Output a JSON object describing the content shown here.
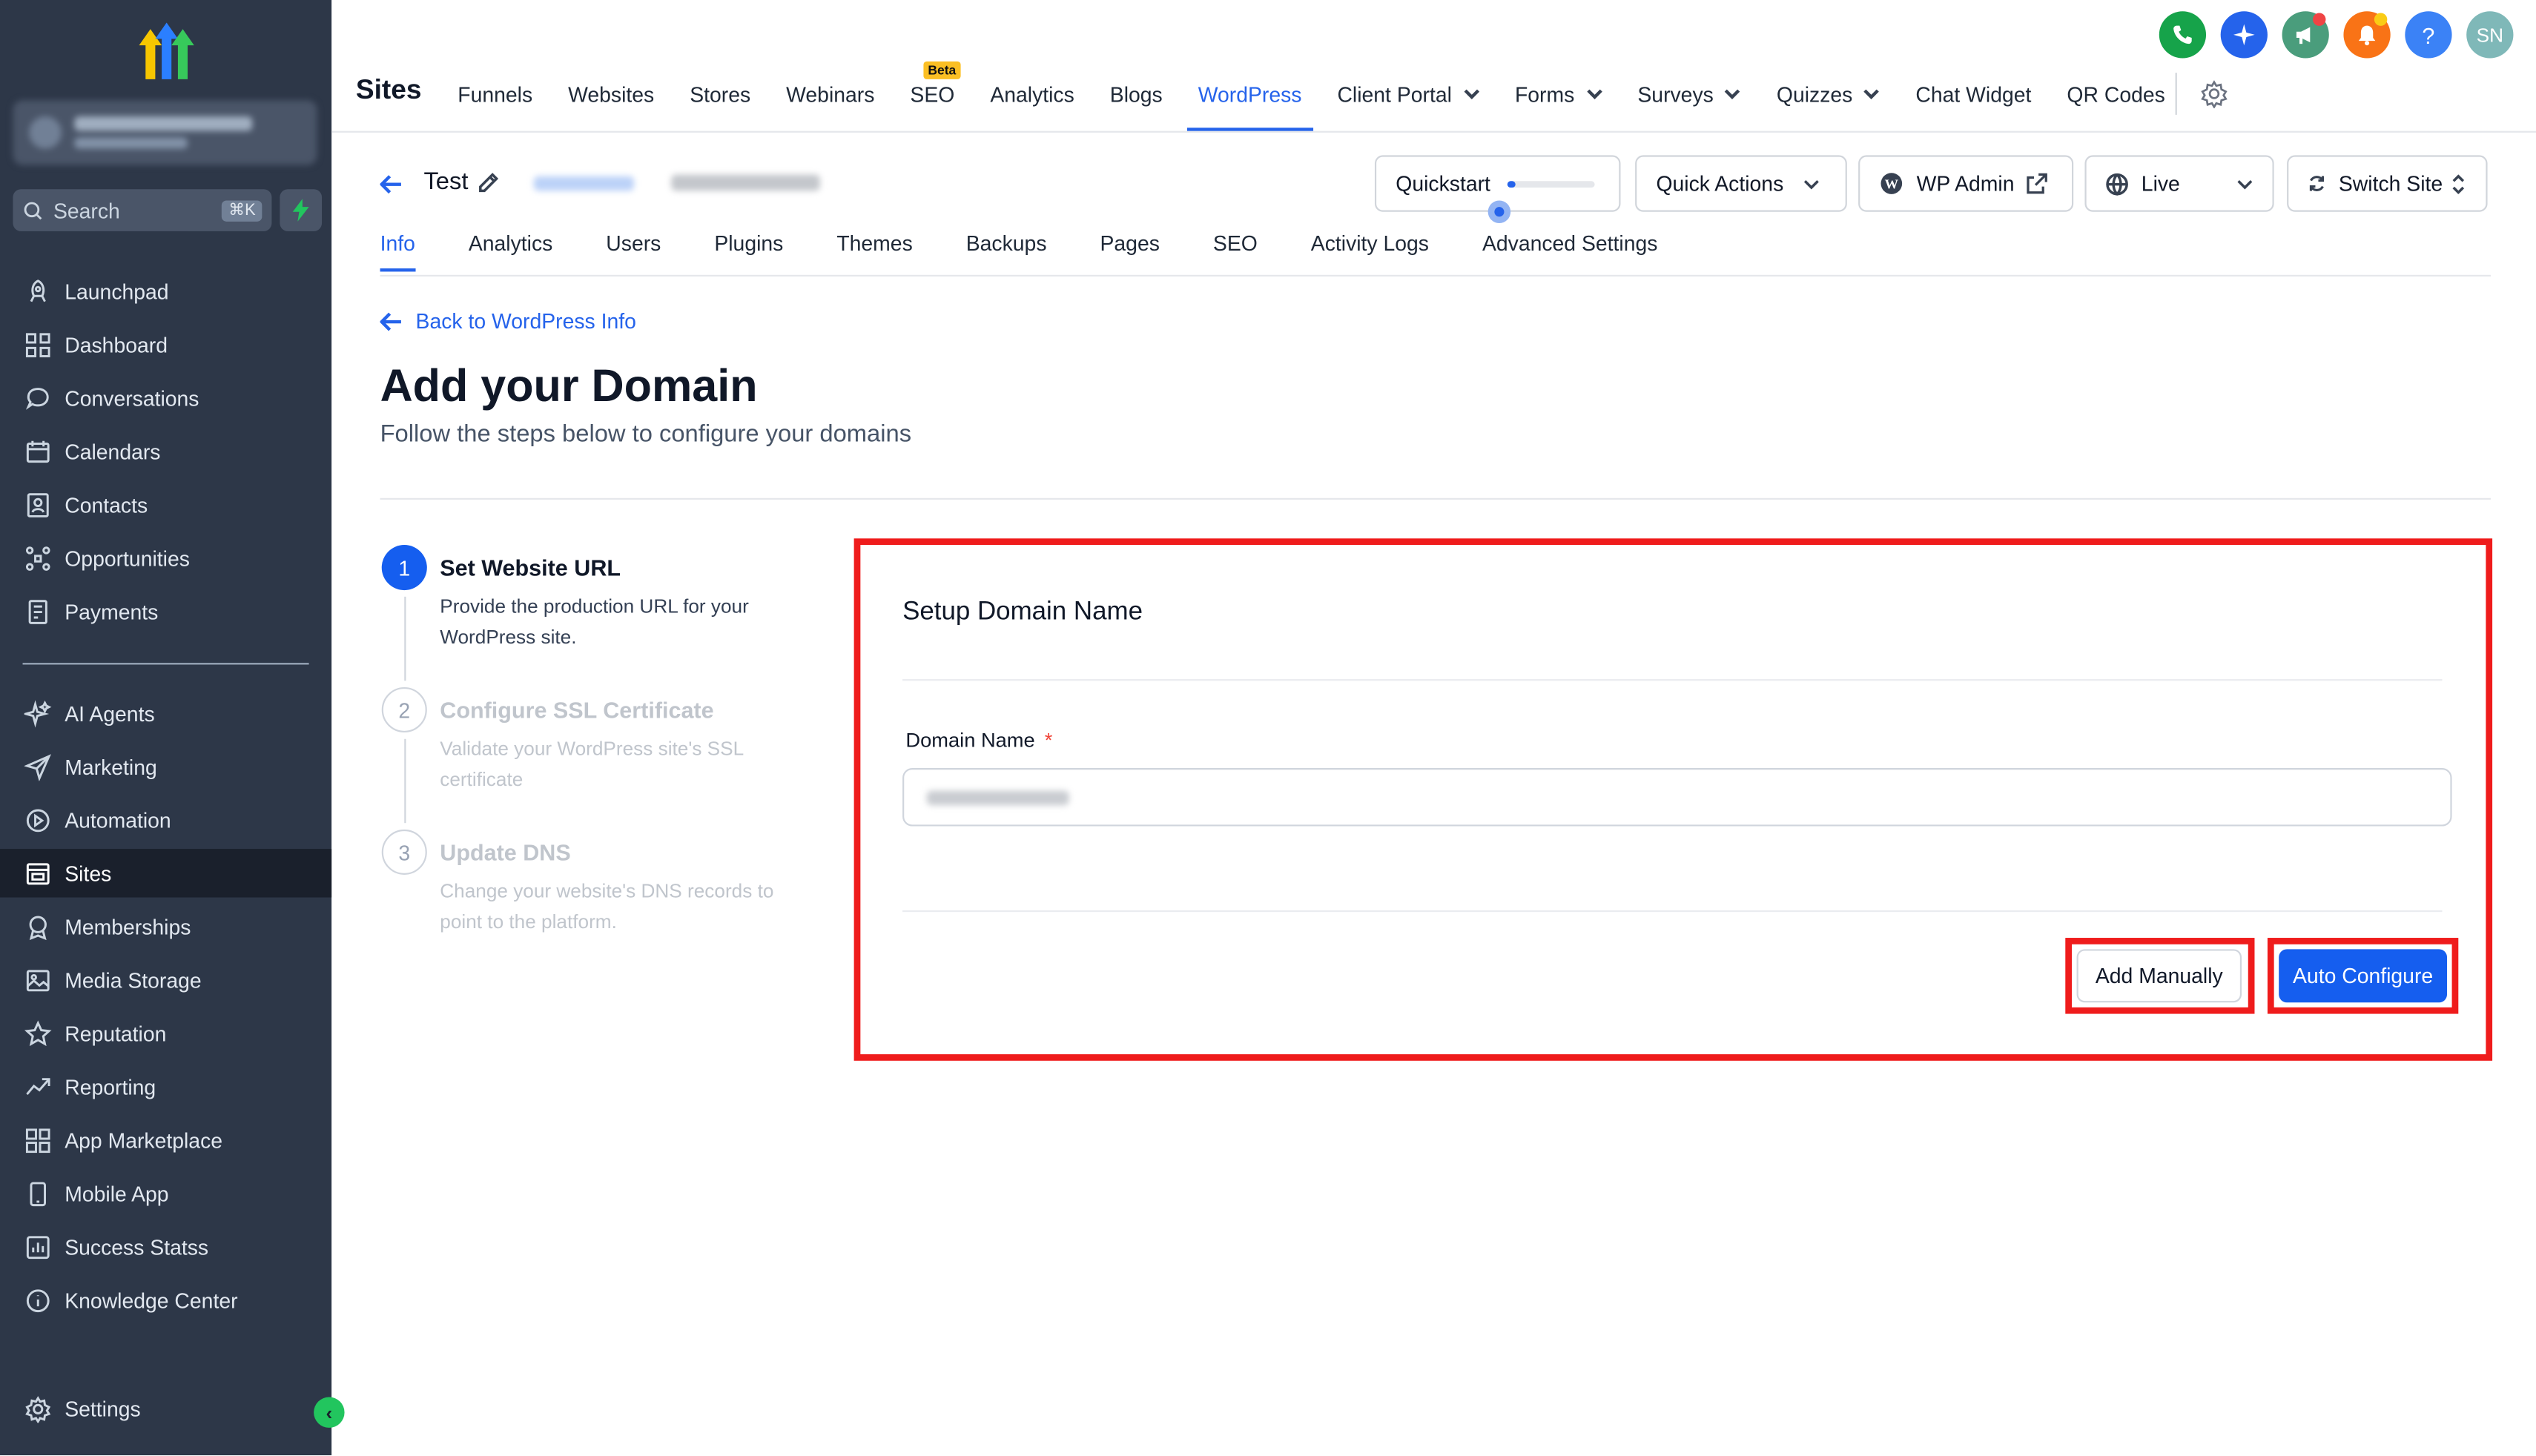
{
  "sidebar": {
    "search_placeholder": "Search",
    "search_shortcut": "⌘K",
    "items_top": [
      {
        "label": "Launchpad",
        "icon": "rocket-icon"
      },
      {
        "label": "Dashboard",
        "icon": "grid-icon"
      },
      {
        "label": "Conversations",
        "icon": "chat-icon"
      },
      {
        "label": "Calendars",
        "icon": "calendar-icon"
      },
      {
        "label": "Contacts",
        "icon": "contacts-icon"
      },
      {
        "label": "Opportunities",
        "icon": "opportunities-icon"
      },
      {
        "label": "Payments",
        "icon": "payments-icon"
      }
    ],
    "items_bottom": [
      {
        "label": "AI Agents",
        "icon": "sparkle-icon"
      },
      {
        "label": "Marketing",
        "icon": "send-icon"
      },
      {
        "label": "Automation",
        "icon": "automation-icon"
      },
      {
        "label": "Sites",
        "icon": "sites-icon"
      },
      {
        "label": "Memberships",
        "icon": "badge-icon"
      },
      {
        "label": "Media Storage",
        "icon": "image-icon"
      },
      {
        "label": "Reputation",
        "icon": "star-icon"
      },
      {
        "label": "Reporting",
        "icon": "trend-icon"
      },
      {
        "label": "App Marketplace",
        "icon": "apps-icon"
      },
      {
        "label": "Mobile App",
        "icon": "phone-icon"
      },
      {
        "label": "Success Statss",
        "icon": "stats-icon"
      },
      {
        "label": "Knowledge Center",
        "icon": "info-icon"
      }
    ],
    "settings_label": "Settings",
    "active_item": "Sites"
  },
  "header": {
    "title": "Sites",
    "nav": [
      {
        "label": "Funnels"
      },
      {
        "label": "Websites"
      },
      {
        "label": "Stores"
      },
      {
        "label": "Webinars"
      },
      {
        "label": "SEO",
        "badge": "Beta"
      },
      {
        "label": "Analytics"
      },
      {
        "label": "Blogs"
      },
      {
        "label": "WordPress",
        "active": true
      },
      {
        "label": "Client Portal",
        "dropdown": true
      },
      {
        "label": "Forms",
        "dropdown": true
      },
      {
        "label": "Surveys",
        "dropdown": true
      },
      {
        "label": "Quizzes",
        "dropdown": true
      },
      {
        "label": "Chat Widget"
      },
      {
        "label": "QR Codes"
      }
    ],
    "user_initials": "SN",
    "colors": {
      "phone": "#16a34a",
      "sparkle": "#2563eb",
      "megaphone": "#4a9d7c",
      "bell": "#f97316",
      "help": "#3b82f6",
      "avatar": "#7fb8b8"
    }
  },
  "site_bar": {
    "site_name": "Test",
    "quickstart_label": "Quickstart",
    "quickstart_progress": 0.1,
    "quick_actions_label": "Quick Actions",
    "wp_admin_label": "WP Admin",
    "status_label": "Live",
    "switch_site_label": "Switch Site"
  },
  "subtabs": [
    "Info",
    "Analytics",
    "Users",
    "Plugins",
    "Themes",
    "Backups",
    "Pages",
    "SEO",
    "Activity Logs",
    "Advanced Settings"
  ],
  "page": {
    "back_link": "Back to WordPress Info",
    "title": "Add your Domain",
    "subtitle": "Follow the steps below to configure your domains"
  },
  "steps": [
    {
      "number": "1",
      "title": "Set Website URL",
      "description": "Provide the production URL for your WordPress site.",
      "active": true
    },
    {
      "number": "2",
      "title": "Configure SSL Certificate",
      "description": "Validate your WordPress site's SSL certificate",
      "active": false
    },
    {
      "number": "3",
      "title": "Update DNS",
      "description": "Change your website's DNS records to point to the platform.",
      "active": false
    }
  ],
  "card": {
    "title": "Setup Domain Name",
    "field_label": "Domain Name",
    "required_mark": "*",
    "add_manually_label": "Add Manually",
    "auto_configure_label": "Auto Configure"
  }
}
